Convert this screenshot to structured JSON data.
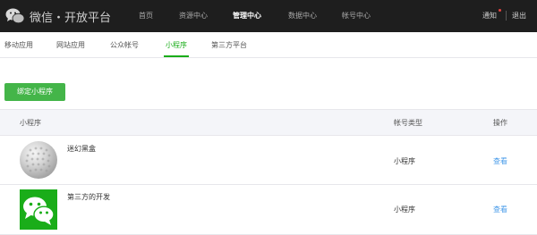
{
  "header": {
    "brand": "微信・开放平台",
    "nav": [
      {
        "label": "首页",
        "active": false
      },
      {
        "label": "资源中心",
        "active": false
      },
      {
        "label": "管理中心",
        "active": true
      },
      {
        "label": "数据中心",
        "active": false
      },
      {
        "label": "帐号中心",
        "active": false
      }
    ],
    "notice_label": "通知",
    "logout_label": "退出"
  },
  "subnav": {
    "items": [
      {
        "label": "移动应用",
        "active": false
      },
      {
        "label": "网站应用",
        "active": false
      },
      {
        "label": "公众帐号",
        "active": false
      },
      {
        "label": "小程序",
        "active": true
      },
      {
        "label": "第三方平台",
        "active": false
      }
    ]
  },
  "actions": {
    "bind_button": "绑定小程序"
  },
  "table": {
    "columns": [
      "小程序",
      "帐号类型",
      "操作"
    ],
    "rows": [
      {
        "name": "迷幻黑盒",
        "type": "小程序",
        "action": "查看",
        "icon": "golf-ball-thumbnail"
      },
      {
        "name": "第三方的开发",
        "type": "小程序",
        "action": "查看",
        "icon": "wechat-logo-thumbnail"
      }
    ]
  },
  "colors": {
    "topbar": "#1e1e1e",
    "accent_green": "#1aad19",
    "button_green": "#44b549",
    "link_blue": "#459ae9",
    "notice_dot": "#e64340"
  }
}
